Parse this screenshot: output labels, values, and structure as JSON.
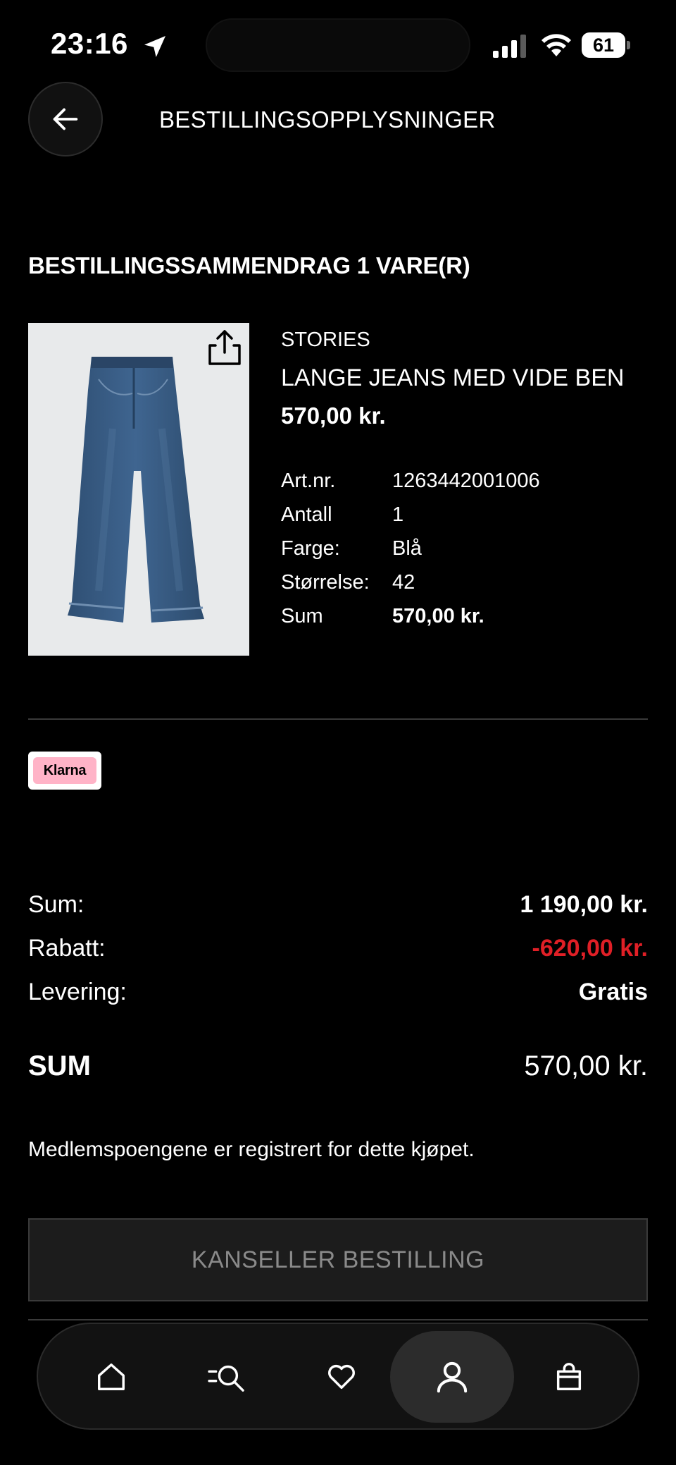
{
  "status": {
    "time": "23:16",
    "battery": "61"
  },
  "header": {
    "title": "BESTILLINGSOPPLYSNINGER"
  },
  "summary": {
    "title": "BESTILLINGSSAMMENDRAG 1 VARE(R)"
  },
  "product": {
    "brand": "STORIES",
    "name": "LANGE JEANS MED VIDE BEN",
    "price": "570,00 kr.",
    "details": [
      {
        "label": "Art.nr.",
        "value": "1263442001006"
      },
      {
        "label": "Antall",
        "value": "1"
      },
      {
        "label": "Farge:",
        "value": "Blå"
      },
      {
        "label": "Størrelse:",
        "value": "42"
      },
      {
        "label": "Sum",
        "value": "570,00 kr."
      }
    ]
  },
  "payment": {
    "method": "Klarna",
    "brand_color": "#ffb3c7"
  },
  "totals": {
    "rows": [
      {
        "label": "Sum:",
        "value": "1 190,00 kr."
      },
      {
        "label": "Rabatt:",
        "value": "-620,00 kr.",
        "color": "#e01f26"
      },
      {
        "label": "Levering:",
        "value": "Gratis"
      }
    ],
    "grand_label": "SUM",
    "grand_value": "570,00 kr."
  },
  "member_note": "Medlemspoengene er registrert for dette kjøpet.",
  "cancel_button": "KANSELLER BESTILLING",
  "nav": {
    "items": [
      "home-icon",
      "search-icon",
      "heart-icon",
      "profile-icon",
      "shopping-bag-icon"
    ],
    "active": "profile-icon"
  }
}
